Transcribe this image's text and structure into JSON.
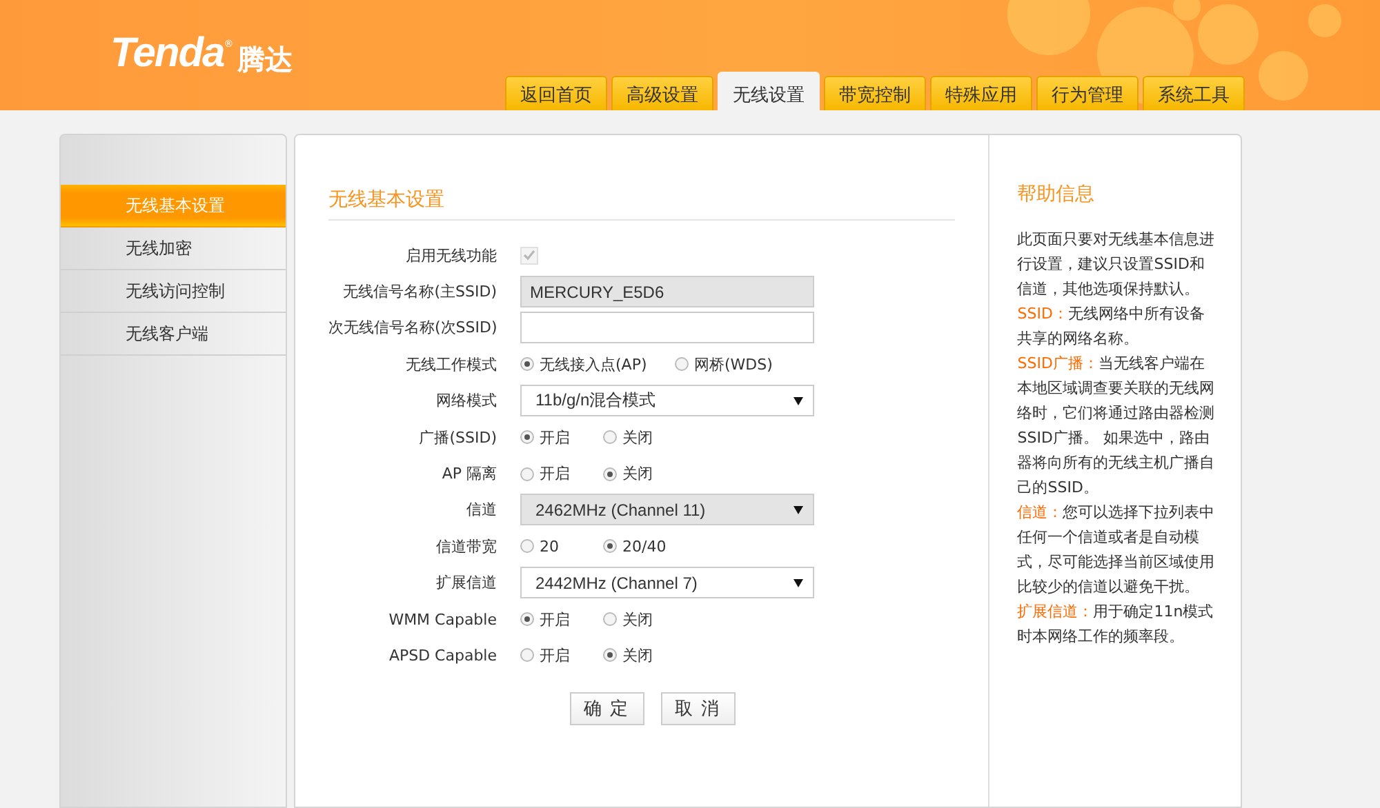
{
  "logo": {
    "brand": "Tenda",
    "mark": "®",
    "name": "腾达"
  },
  "nav_tabs": [
    {
      "label": "返回首页",
      "selected": false
    },
    {
      "label": "高级设置",
      "selected": false
    },
    {
      "label": "无线设置",
      "selected": true
    },
    {
      "label": "带宽控制",
      "selected": false
    },
    {
      "label": "特殊应用",
      "selected": false
    },
    {
      "label": "行为管理",
      "selected": false
    },
    {
      "label": "系统工具",
      "selected": false
    }
  ],
  "sidebar": {
    "items": [
      {
        "label": "无线基本设置",
        "selected": true
      },
      {
        "label": "无线加密",
        "selected": false
      },
      {
        "label": "无线访问控制",
        "selected": false
      },
      {
        "label": "无线客户端",
        "selected": false
      }
    ]
  },
  "form": {
    "title": "无线基本设置",
    "rows": [
      {
        "kind": "checkbox",
        "label": "启用无线功能",
        "checked": true,
        "disabled": true
      },
      {
        "kind": "text",
        "label": "无线信号名称(主SSID)",
        "value": "MERCURY_E5D6",
        "disabled": true
      },
      {
        "kind": "text",
        "label": "次无线信号名称(次SSID)",
        "disabled": false
      },
      {
        "kind": "radio",
        "label": "无线工作模式",
        "options": [
          {
            "label": "无线接入点(AP)",
            "selected": true
          },
          {
            "label": "网桥(WDS)",
            "selected": false
          }
        ]
      },
      {
        "kind": "select",
        "label": "网络模式",
        "value": "11b/g/n混合模式",
        "disabled": false
      },
      {
        "kind": "radio",
        "label": "广播(SSID)",
        "options": [
          {
            "label": "开启",
            "selected": true
          },
          {
            "label": "关闭",
            "selected": false
          }
        ]
      },
      {
        "kind": "radio",
        "label": "AP 隔离",
        "options": [
          {
            "label": "开启",
            "selected": false
          },
          {
            "label": "关闭",
            "selected": true
          }
        ]
      },
      {
        "kind": "select",
        "label": "信道",
        "value": "2462MHz (Channel 11)",
        "disabled": true
      },
      {
        "kind": "radio",
        "label": "信道带宽",
        "options": [
          {
            "label": "20",
            "selected": false
          },
          {
            "label": "20/40",
            "selected": true
          }
        ]
      },
      {
        "kind": "select",
        "label": "扩展信道",
        "value": "2442MHz (Channel 7)",
        "disabled": false
      },
      {
        "kind": "radio",
        "label": "WMM Capable",
        "options": [
          {
            "label": "开启",
            "selected": true
          },
          {
            "label": "关闭",
            "selected": false
          }
        ]
      },
      {
        "kind": "radio",
        "label": "APSD Capable",
        "options": [
          {
            "label": "开启",
            "selected": false
          },
          {
            "label": "关闭",
            "selected": true
          }
        ]
      }
    ],
    "buttons": [
      "确 定",
      "取 消"
    ]
  },
  "help": {
    "title": "帮助信息",
    "paragraphs": [
      {
        "text": "此页面只要对无线基本信息进行设置，建议只设置SSID和信道，其他选项保持默认。"
      },
      {
        "term": "SSID：",
        "text": "无线网络中所有设备共享的网络名称。"
      },
      {
        "term": "SSID广播：",
        "text": "当无线客户端在本地区域调查要关联的无线网络时，它们将通过路由器检测SSID广播。 如果选中，路由器将向所有的无线主机广播自己的SSID。"
      },
      {
        "term": "信道：",
        "text": "您可以选择下拉列表中任何一个信道或者是自动模式，尽可能选择当前区域使用比较少的信道以避免干扰。"
      },
      {
        "term": "扩展信道：",
        "text": "用于确定11n模式时本网络工作的频率段。"
      }
    ]
  }
}
